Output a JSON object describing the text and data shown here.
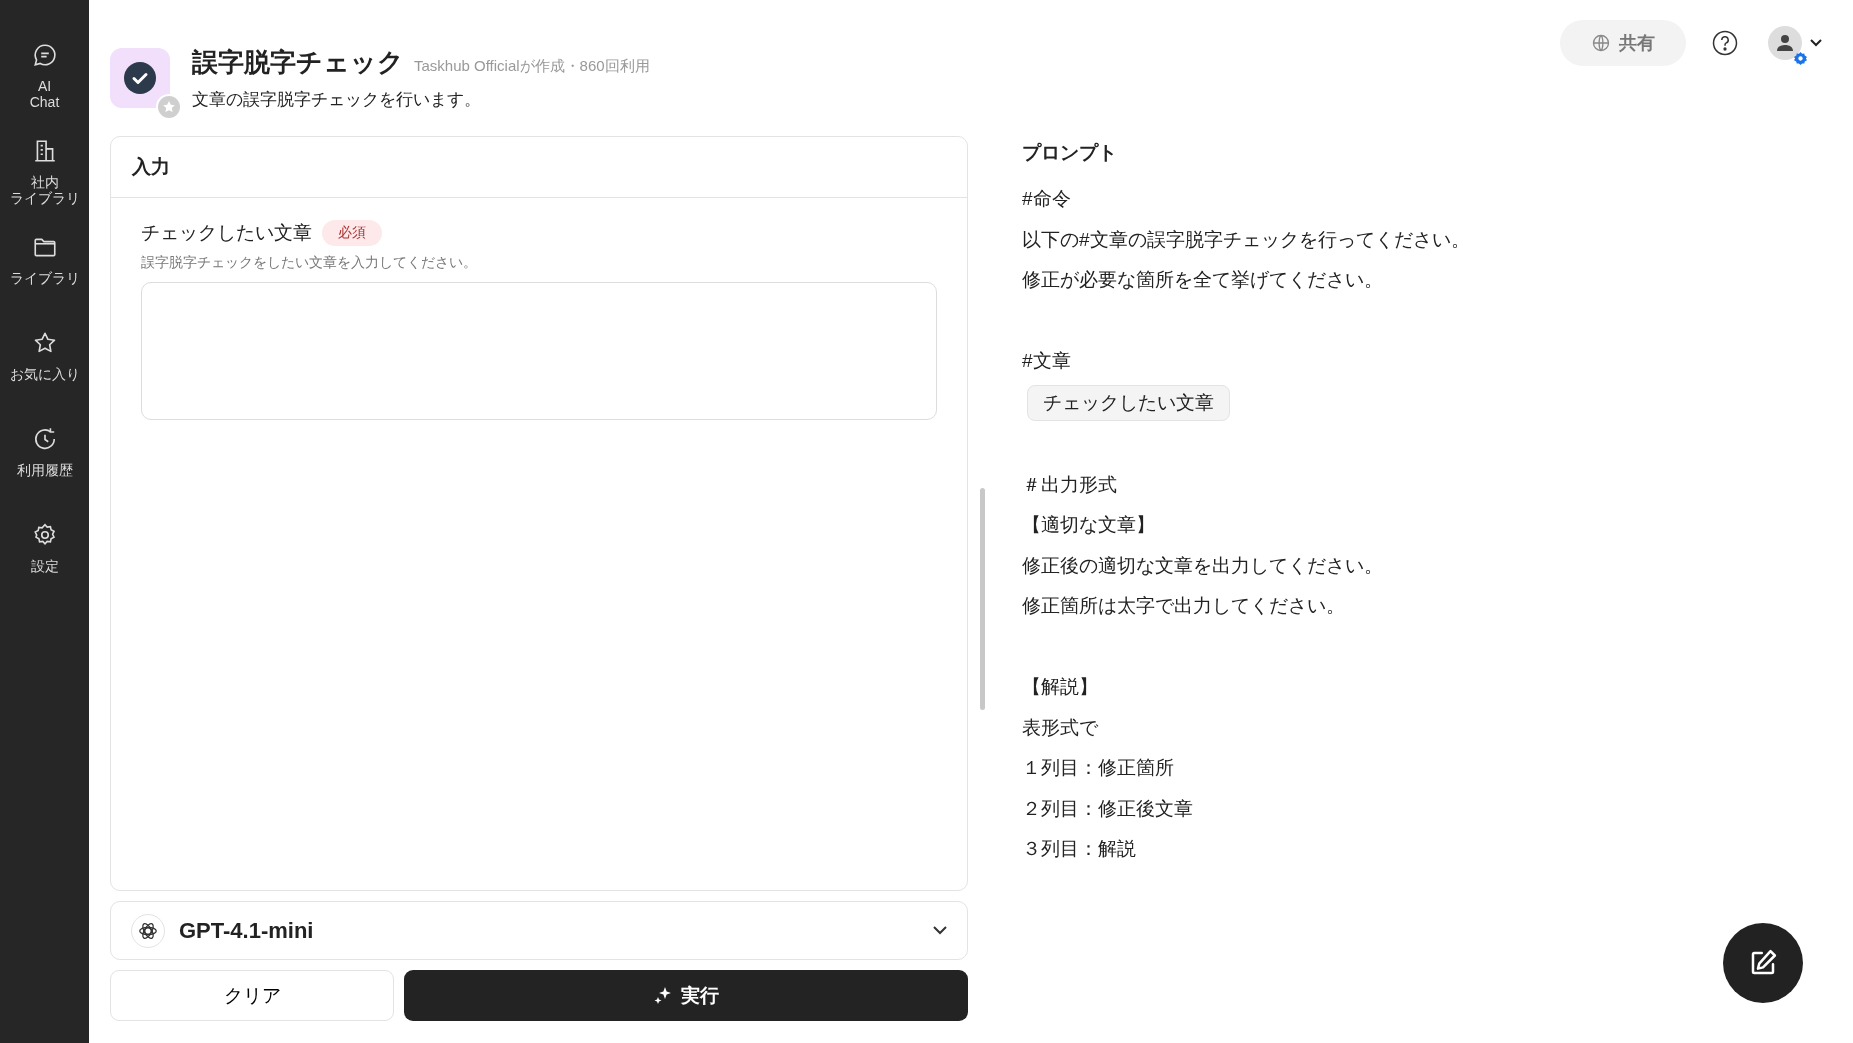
{
  "sidebar": {
    "items": [
      {
        "kind": "chat",
        "lines": [
          "AI",
          "Chat"
        ],
        "selected": false
      },
      {
        "kind": "building",
        "lines": [
          "社内",
          "ライブラリ"
        ],
        "selected": false
      },
      {
        "kind": "folder",
        "lines": [
          "ライブラリ"
        ],
        "selected": false
      },
      {
        "kind": "star",
        "lines": [
          "お気に入り"
        ],
        "selected": false
      },
      {
        "kind": "history",
        "lines": [
          "利用履歴"
        ],
        "selected": false
      },
      {
        "kind": "settings",
        "lines": [
          "設定"
        ],
        "selected": false
      }
    ]
  },
  "header": {
    "title": "誤字脱字チェック",
    "meta": "Taskhub Officialが作成・860回利用",
    "description": "文章の誤字脱字チェックを行います。",
    "favorite": false
  },
  "top_bar": {
    "share_button": "共有"
  },
  "input_panel": {
    "title": "入力",
    "field": {
      "label": "チェックしたい文章",
      "required_badge": "必須",
      "hint": "誤字脱字チェックをしたい文章を入力してください。"
    }
  },
  "model_select": {
    "value": "GPT-4.1-mini"
  },
  "buttons": {
    "clear": "クリア",
    "run": "実行"
  },
  "prompt": {
    "title": "プロンプト",
    "lines": [
      {
        "kind": "text",
        "text": "#命令"
      },
      {
        "kind": "text",
        "text": "以下の#文章の誤字脱字チェックを行ってください。"
      },
      {
        "kind": "text",
        "text": "修正が必要な箇所を全て挙げてください。"
      },
      {
        "kind": "blank"
      },
      {
        "kind": "text",
        "text": "#文章"
      },
      {
        "kind": "variable",
        "text": "チェックしたい文章"
      },
      {
        "kind": "blank"
      },
      {
        "kind": "text",
        "text": "＃出力形式"
      },
      {
        "kind": "text",
        "text": "【適切な文章】"
      },
      {
        "kind": "text",
        "text": "修正後の適切な文章を出力してください。"
      },
      {
        "kind": "text",
        "text": "修正箇所は太字で出力してください。"
      },
      {
        "kind": "blank"
      },
      {
        "kind": "text",
        "text": "【解説】"
      },
      {
        "kind": "text",
        "text": "表形式で"
      },
      {
        "kind": "text",
        "text": "１列目：修正箇所"
      },
      {
        "kind": "text",
        "text": "２列目：修正後文章"
      },
      {
        "kind": "text",
        "text": "３列目：解説"
      }
    ]
  }
}
